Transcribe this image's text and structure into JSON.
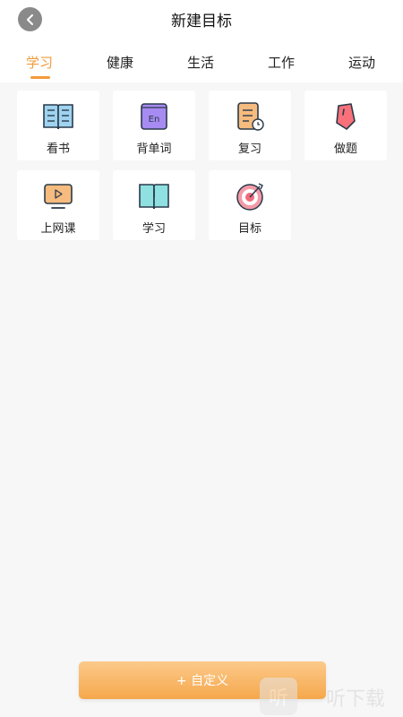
{
  "header": {
    "title": "新建目标"
  },
  "tabs": [
    {
      "label": "学习",
      "active": true
    },
    {
      "label": "健康",
      "active": false
    },
    {
      "label": "生活",
      "active": false
    },
    {
      "label": "工作",
      "active": false
    },
    {
      "label": "运动",
      "active": false
    }
  ],
  "items": [
    {
      "label": "看书",
      "icon": "open-book-icon"
    },
    {
      "label": "背单词",
      "icon": "english-book-icon"
    },
    {
      "label": "复习",
      "icon": "notebook-clock-icon"
    },
    {
      "label": "做题",
      "icon": "eraser-icon"
    },
    {
      "label": "上网课",
      "icon": "video-lesson-icon"
    },
    {
      "label": "学习",
      "icon": "study-book-icon"
    },
    {
      "label": "目标",
      "icon": "target-icon"
    }
  ],
  "custom_button": {
    "label": "+ 自定义"
  },
  "watermark": {
    "logo_char": "听",
    "text": "听下载"
  },
  "colors": {
    "accent": "#f29b3a",
    "button_gradient_top": "#fcc98a",
    "button_gradient_bottom": "#f5a84c"
  }
}
